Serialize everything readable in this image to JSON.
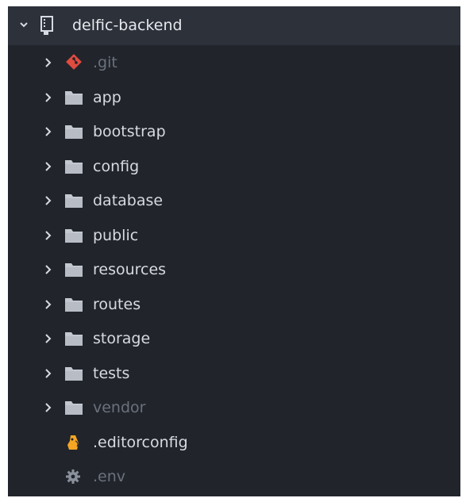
{
  "colors": {
    "panel_bg": "#21252b",
    "header_bg": "#2c313a",
    "text": "#d7dae0",
    "dim_text": "#6b717d",
    "folder_icon": "#c3c8d0",
    "git_icon": "#e04b3f",
    "editorconfig_icon": "#f5a524",
    "gear_icon": "#8b919c"
  },
  "project": {
    "name": "delfic-backend",
    "icon": "repo-icon",
    "expanded": true
  },
  "tree": {
    "items": [
      {
        "label": ".git",
        "type": "folder",
        "icon": "git-icon",
        "dim": true
      },
      {
        "label": "app",
        "type": "folder",
        "icon": "folder-icon",
        "dim": false
      },
      {
        "label": "bootstrap",
        "type": "folder",
        "icon": "folder-icon",
        "dim": false
      },
      {
        "label": "config",
        "type": "folder",
        "icon": "folder-icon",
        "dim": false
      },
      {
        "label": "database",
        "type": "folder",
        "icon": "folder-icon",
        "dim": false
      },
      {
        "label": "public",
        "type": "folder",
        "icon": "folder-icon",
        "dim": false
      },
      {
        "label": "resources",
        "type": "folder",
        "icon": "folder-icon",
        "dim": false
      },
      {
        "label": "routes",
        "type": "folder",
        "icon": "folder-icon",
        "dim": false
      },
      {
        "label": "storage",
        "type": "folder",
        "icon": "folder-icon",
        "dim": false
      },
      {
        "label": "tests",
        "type": "folder",
        "icon": "folder-icon",
        "dim": false
      },
      {
        "label": "vendor",
        "type": "folder",
        "icon": "folder-icon",
        "dim": true
      },
      {
        "label": ".editorconfig",
        "type": "file",
        "icon": "editorconfig-icon",
        "dim": false
      },
      {
        "label": ".env",
        "type": "file",
        "icon": "gear-icon",
        "dim": true
      }
    ]
  }
}
